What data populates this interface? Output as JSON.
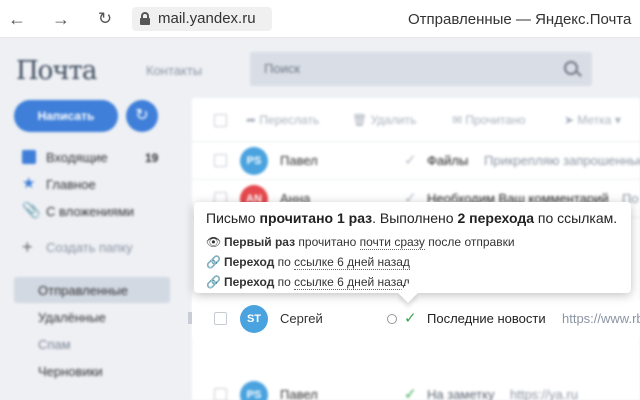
{
  "browser": {
    "url": "mail.yandex.ru",
    "tab_title": "Отправленные — Яндекс.Почта"
  },
  "header": {
    "logo": "Почта",
    "contacts_label": "Контакты",
    "search_placeholder": "Поиск"
  },
  "sidebar": {
    "compose_label": "Написать",
    "folders": [
      {
        "label": "Входящие",
        "count": "19"
      },
      {
        "label": "Главное"
      },
      {
        "label": "С вложениями"
      }
    ],
    "create_folder_label": "Создать папку",
    "system_folders": [
      "Отправленные",
      "Удалённые",
      "Спам",
      "Черновики"
    ]
  },
  "toolbar": {
    "forward": "Переслать",
    "delete": "Удалить",
    "read": "Прочитано",
    "tag": "Метка"
  },
  "messages": [
    {
      "initials": "PS",
      "sender": "Павел",
      "subject": "Файлы",
      "snippet": "Прикрепляю запрошенные",
      "avatar_color": "#4aa3df"
    },
    {
      "initials": "AN",
      "sender": "Анна",
      "subject": "Необходим Ваш комментарий",
      "snippet": "По",
      "avatar_color": "#e5484d"
    },
    {
      "initials": "ST",
      "sender": "Сергей",
      "subject": "Последние новости",
      "snippet": "https://www.rb",
      "avatar_color": "#4aa3df"
    },
    {
      "initials": "PS",
      "sender": "Павел",
      "subject": "На заметку",
      "snippet": "https://ya.ru",
      "avatar_color": "#4aa3df"
    }
  ],
  "tooltip": {
    "head_prefix": "Письмо ",
    "head_read": "прочитано 1 раз",
    "head_mid": ". Выполнено ",
    "head_clicks": "2 перехода",
    "head_suffix": " по ссылкам.",
    "line1_bold": "Первый раз",
    "line1_text": " прочитано ",
    "line1_link": "почти сразу",
    "line1_tail": " после отправки",
    "line2_bold": "Переход",
    "line2_text": " по ",
    "line2_link": "ссылке 6 дней назад",
    "line3_bold": "Переход",
    "line3_text": " по ",
    "line3_link": "ссылке 6 дней назад"
  }
}
